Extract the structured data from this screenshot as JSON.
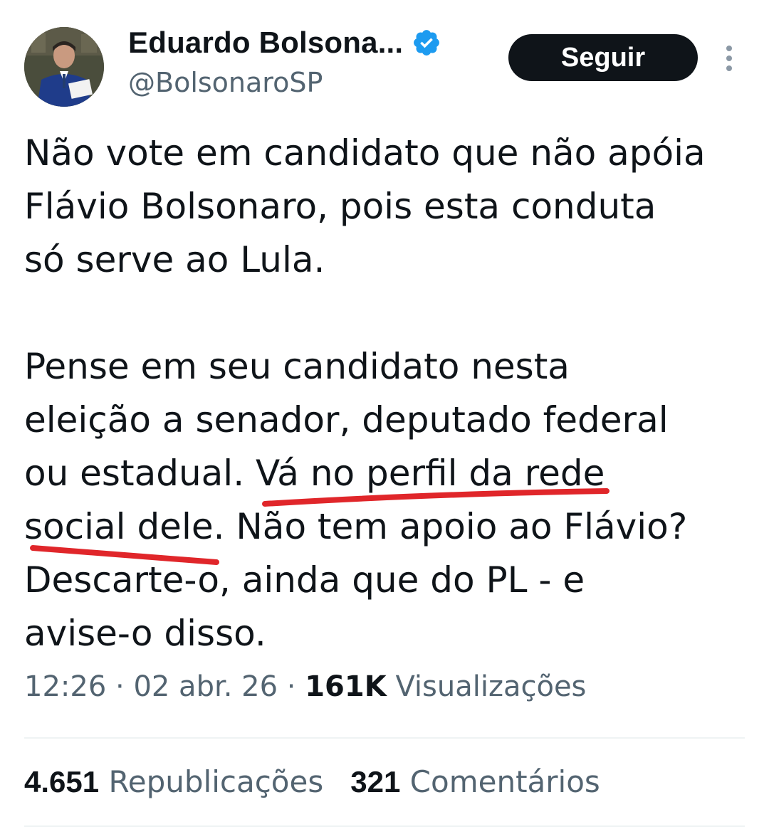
{
  "author": {
    "display_name": "Eduardo Bolsona...",
    "handle": "@BolsonaroSP",
    "verified": true,
    "avatar_icon": "profile-photo"
  },
  "actions": {
    "follow_label": "Seguir",
    "more_icon": "vertical-ellipsis-icon"
  },
  "tweet": {
    "text_part1": "Não vote em candidato que não apóia\nFlávio Bolsonaro, pois esta conduta\nsó serve ao Lula.\n\nPense em seu candidato nesta\neleição a senador, deputado federal\nou estadual. ",
    "text_highlight": "Vá no perfil da rede\nsocial dele",
    "text_part2": ". Não tem apoio ao Flávio?\nDescarte-o, ainda que do PL - e\navise-o disso."
  },
  "meta": {
    "time": "12:26",
    "date": "02 abr. 26",
    "views_count": "161K",
    "views_label": "Visualizações"
  },
  "stats": {
    "reposts_count": "4.651",
    "reposts_label": "Republicações",
    "comments_count": "321",
    "comments_label": "Comentários"
  },
  "colors": {
    "verified_blue": "#1d9bf0",
    "underline_red": "#e0262a",
    "button_bg": "#0f1419",
    "secondary_text": "#536471"
  }
}
